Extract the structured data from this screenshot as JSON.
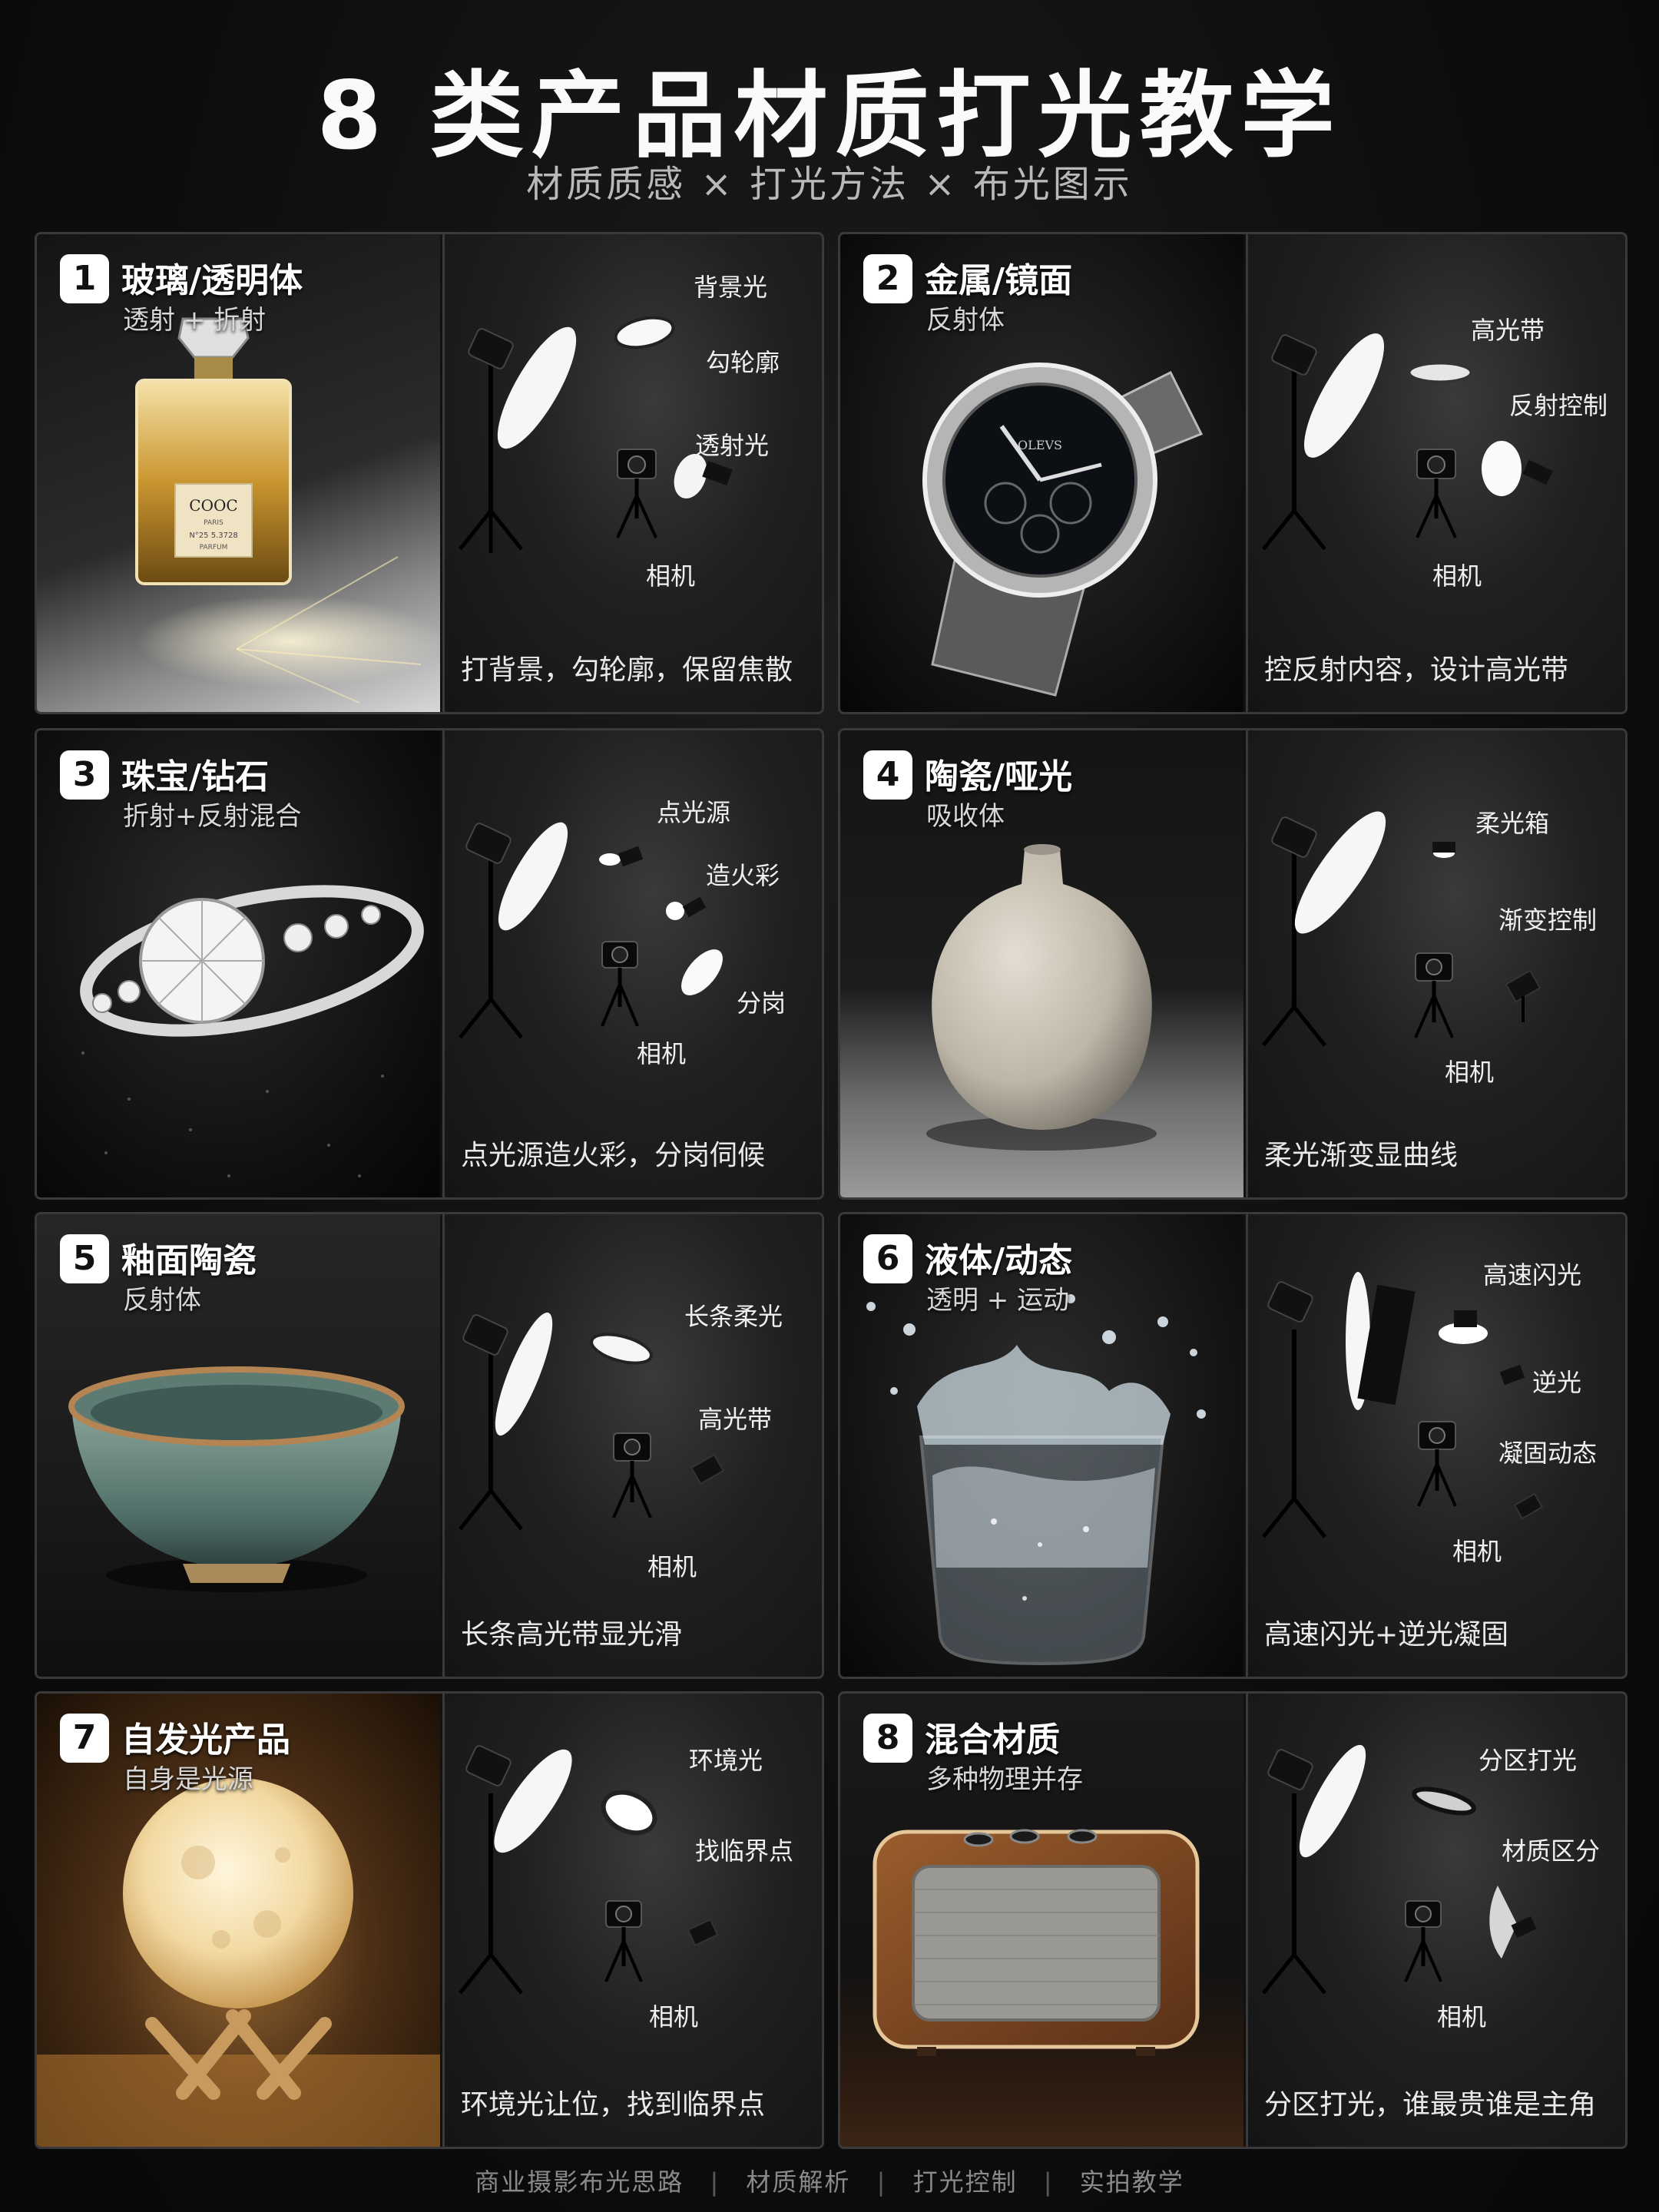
{
  "header": {
    "title": "8 类产品材质打光教学",
    "subtitle": "材质质感 × 打光方法 × 布光图示"
  },
  "cards": [
    {
      "num": "1",
      "title": "玻璃/透明体",
      "sub": "透射 + 折射",
      "labels": [
        "背景光",
        "勾轮廓",
        "透射光",
        "相机"
      ],
      "caption": "打背景，勾轮廓，保留焦散"
    },
    {
      "num": "2",
      "title": "金属/镜面",
      "sub": "反射体",
      "labels": [
        "高光带",
        "反射控制",
        "相机"
      ],
      "caption": "控反射内容，设计高光带"
    },
    {
      "num": "3",
      "title": "珠宝/钻石",
      "sub": "折射+反射混合",
      "labels": [
        "点光源",
        "造火彩",
        "分岗",
        "相机"
      ],
      "caption": "点光源造火彩，分岗伺候"
    },
    {
      "num": "4",
      "title": "陶瓷/哑光",
      "sub": "吸收体",
      "labels": [
        "柔光箱",
        "渐变控制",
        "相机"
      ],
      "caption": "柔光渐变显曲线"
    },
    {
      "num": "5",
      "title": "釉面陶瓷",
      "sub": "反射体",
      "labels": [
        "长条柔光",
        "高光带",
        "相机"
      ],
      "caption": "长条高光带显光滑"
    },
    {
      "num": "6",
      "title": "液体/动态",
      "sub": "透明 + 运动",
      "labels": [
        "高速闪光",
        "逆光",
        "凝固动态",
        "相机"
      ],
      "caption": "高速闪光+逆光凝固"
    },
    {
      "num": "7",
      "title": "自发光产品",
      "sub": "自身是光源",
      "labels": [
        "环境光",
        "找临界点",
        "相机"
      ],
      "caption": "环境光让位，找到临界点"
    },
    {
      "num": "8",
      "title": "混合材质",
      "sub": "多种物理并存",
      "labels": [
        "分区打光",
        "材质区分",
        "相机"
      ],
      "caption": "分区打光，谁最贵谁是主角"
    }
  ],
  "photo_logos": {
    "perfume_brand": "COOC",
    "perfume_line1": "PARIS",
    "perfume_line2": "N°25 5.3728",
    "perfume_line3": "PARFUM",
    "watch_brand": "OLEVS"
  },
  "footer": {
    "items": [
      "商业摄影布光思路",
      "材质解析",
      "打光控制",
      "实拍教学"
    ],
    "separator": "|"
  },
  "colors": {
    "background": "#0d0d0d",
    "card_border": "#3a3a3a",
    "badge": "#ffffff",
    "caption": "#eaeaea"
  }
}
